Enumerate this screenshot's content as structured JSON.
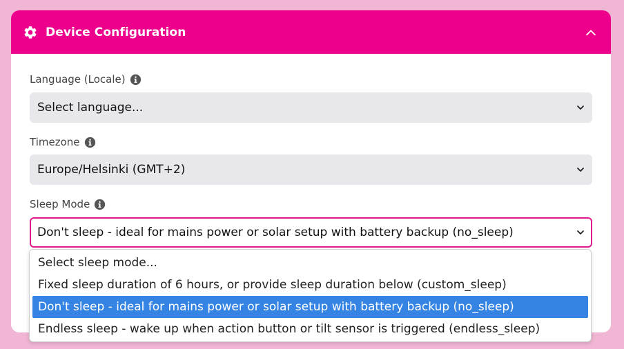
{
  "card": {
    "title": "Device Configuration",
    "header_icon": "gear-icon",
    "collapse_icon": "chevron-up-icon"
  },
  "fields": {
    "language": {
      "label": "Language (Locale)",
      "value": "Select language..."
    },
    "timezone": {
      "label": "Timezone",
      "value": "Europe/Helsinki (GMT+2)"
    },
    "sleep_mode": {
      "label": "Sleep Mode",
      "value": "Don't sleep - ideal for mains power or solar setup with battery backup (no_sleep)"
    }
  },
  "sleep_options": [
    "Select sleep mode...",
    "Fixed sleep duration of 6 hours, or provide sleep duration below (custom_sleep)",
    "Don't sleep - ideal for mains power or solar setup with battery backup (no_sleep)",
    "Endless sleep - wake up when action button or tilt sensor is triggered (endless_sleep)"
  ],
  "colors": {
    "header": "#ec008c",
    "background": "#f0b6d4",
    "highlight": "#3584e4"
  }
}
